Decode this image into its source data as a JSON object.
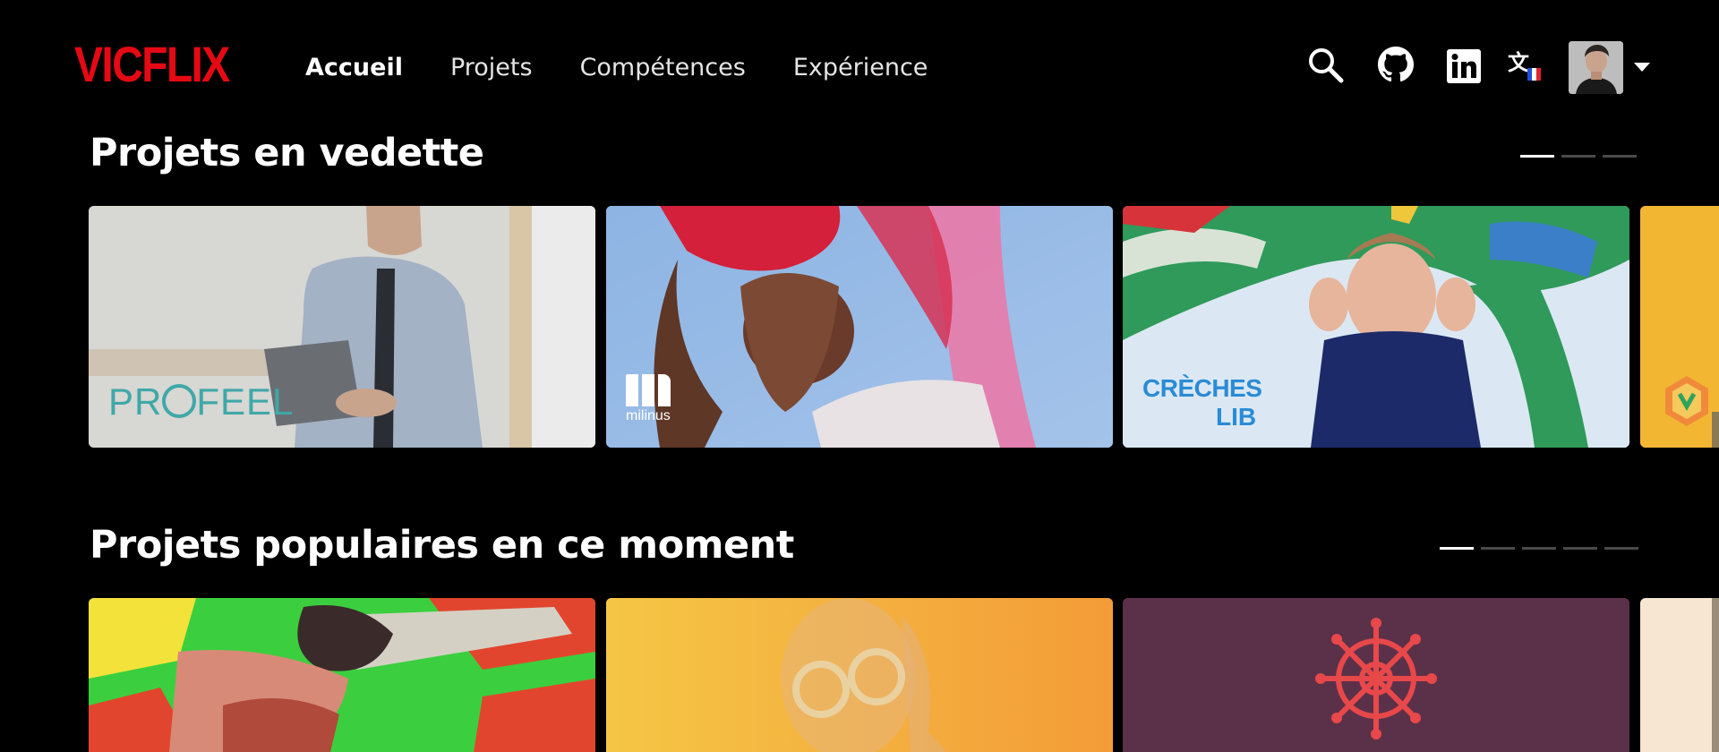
{
  "header": {
    "logo": "VICFLIX",
    "nav": [
      "Accueil",
      "Projets",
      "Compétences",
      "Expérience"
    ],
    "icons": [
      "search-icon",
      "github-icon",
      "linkedin-icon",
      "translate-icon",
      "avatar",
      "chevron-down-icon"
    ]
  },
  "rows": [
    {
      "title": "Projets en vedette",
      "pages": 3,
      "active_page": 1,
      "cards": [
        {
          "label": "PR FEEL",
          "label_display": "PRⓞFEEL"
        },
        {
          "label": "milinus"
        },
        {
          "label": "CRÈCHES LIB"
        },
        {
          "label": ""
        }
      ]
    },
    {
      "title": "Projets populaires en ce moment",
      "pages": 5,
      "active_page": 1,
      "cards": [
        {
          "label": ""
        },
        {
          "label": ""
        },
        {
          "label": ""
        },
        {
          "label": ""
        }
      ]
    }
  ],
  "colors": {
    "brand": "#e50914",
    "background": "#000000"
  }
}
